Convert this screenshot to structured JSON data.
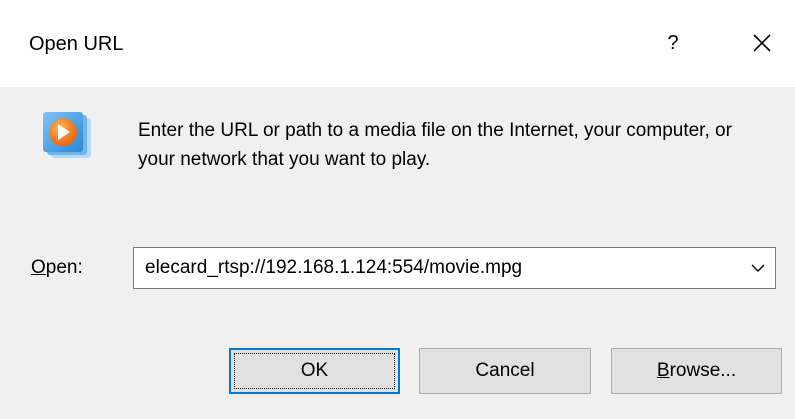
{
  "dialog": {
    "title": "Open URL",
    "help_label": "?",
    "close_icon": "close-icon"
  },
  "message": {
    "icon": "windows-media-player-icon",
    "text": "Enter the URL or path to a media file on the Internet, your computer, or your network that you want to play."
  },
  "open_field": {
    "label_accel": "O",
    "label_rest": "pen:",
    "value": "elecard_rtsp://192.168.1.124:554/movie.mpg",
    "dropdown_icon": "chevron-down-icon"
  },
  "buttons": {
    "ok_label": "OK",
    "cancel_label": "Cancel",
    "browse_accel": "B",
    "browse_rest": "rowse..."
  },
  "colors": {
    "focus_border": "#0078d7",
    "dialog_background": "#f0f0f0",
    "icon_orange": "#f07a1e",
    "icon_blue": "#2a88d8"
  }
}
